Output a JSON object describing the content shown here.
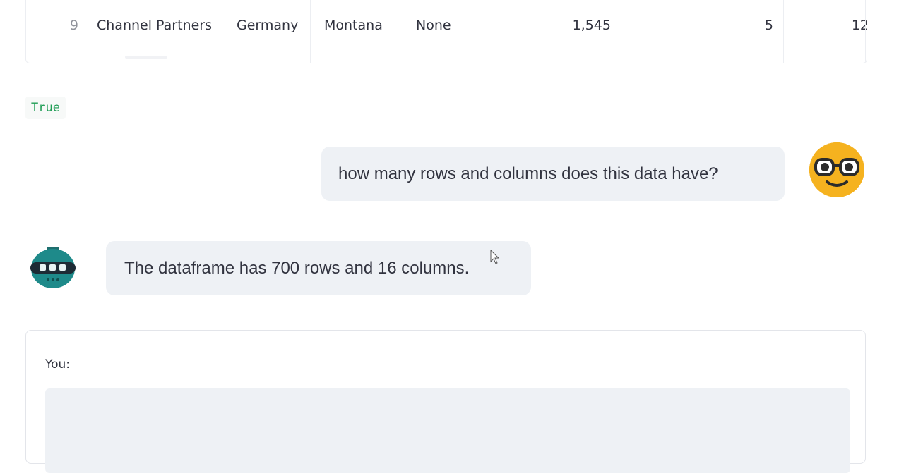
{
  "dataframe": {
    "row": {
      "index": "9",
      "cells": [
        "Channel Partners",
        "Germany",
        "Montana",
        "None",
        "1,545",
        "5",
        "12"
      ]
    }
  },
  "output": {
    "value": "True"
  },
  "chat": {
    "user_message": "how many rows and columns does this data have?",
    "assistant_message": "The dataframe has 700 rows and 16 columns."
  },
  "input": {
    "label": "You:",
    "value": "",
    "placeholder": ""
  },
  "colors": {
    "user_avatar": "#f5b21f",
    "bot_avatar": "#1e8a8a",
    "bubble_bg": "#eef1f5",
    "output_text": "#1f9d55"
  },
  "icons": {
    "user_avatar": "nerd-face-icon",
    "bot_avatar": "robot-icon"
  }
}
